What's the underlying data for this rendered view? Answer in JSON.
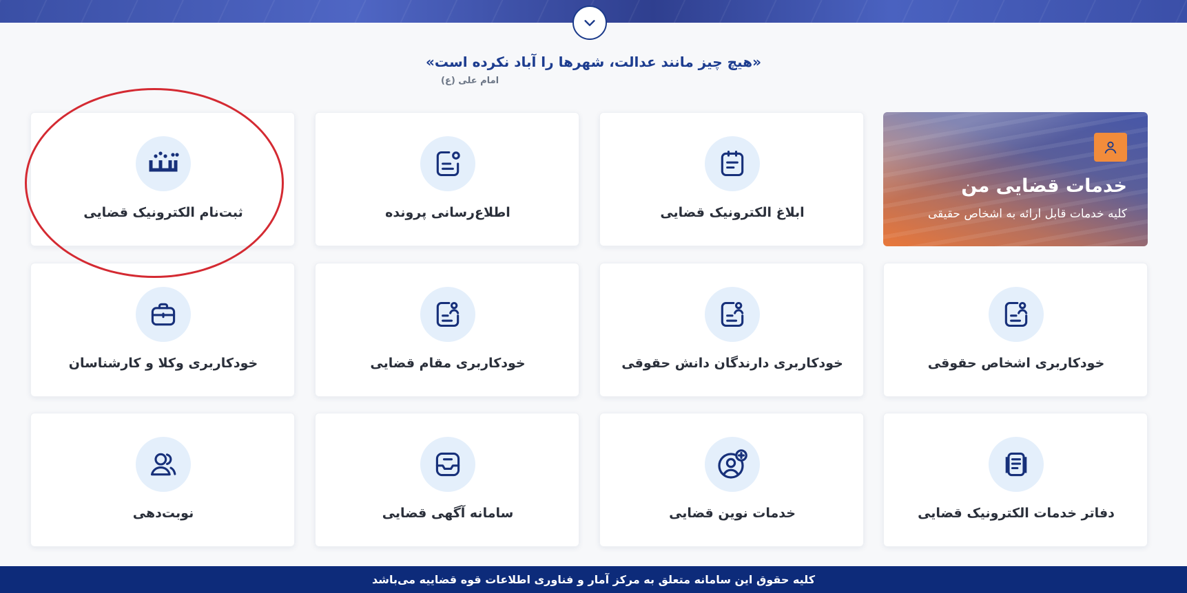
{
  "quote": {
    "text": "«هیچ چیز مانند عدالت، شهرها را آباد نکرده است»",
    "author": "امام علی (ع)"
  },
  "featured_card": {
    "title": "خدمات قضایی من",
    "subtitle": "کلیه خدمات قابل ارائه به اشخاص حقیقی",
    "icon": "user-icon"
  },
  "services": [
    {
      "label": "ثبت‌نام الکترونیک قضایی",
      "icon": "sana-logo-icon"
    },
    {
      "label": "اطلاع‌رسانی پرونده",
      "icon": "notification-document-icon"
    },
    {
      "label": "ابلاغ الکترونیک قضایی",
      "icon": "calendar-note-icon"
    },
    {
      "label": "خودکاربری وکلا و کارشناسان",
      "icon": "briefcase-icon"
    },
    {
      "label": "خودکاربری مقام قضایی",
      "icon": "user-document-icon"
    },
    {
      "label": "خودکاربری دارندگان دانش حقوقی",
      "icon": "user-document-icon"
    },
    {
      "label": "خودکاربری اشخاص حقوقی",
      "icon": "user-document-icon"
    },
    {
      "label": "نوبت‌دهی",
      "icon": "users-icon"
    },
    {
      "label": "سامانه آگهی قضایی",
      "icon": "inbox-icon"
    },
    {
      "label": "خدمات نوین قضایی",
      "icon": "user-add-icon"
    },
    {
      "label": "دفاتر خدمات الکترونیک قضایی",
      "icon": "documents-icon"
    }
  ],
  "footer": {
    "text": "کلیه حقوق این سامانه متعلق به مرکز آمار و فناوری اطلاعات قوه قضاییه می‌باشد"
  },
  "colors": {
    "primary": "#1b3a8a",
    "footer_bg": "#0d2b7a",
    "icon_bg": "#e4effb",
    "accent_orange": "#f28c3b",
    "annotation_red": "#d42a32"
  }
}
